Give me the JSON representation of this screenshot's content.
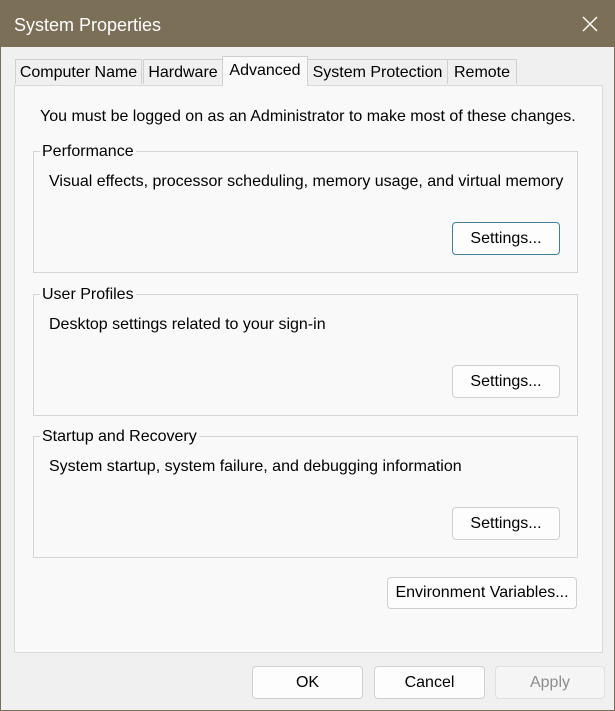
{
  "window": {
    "title": "System Properties",
    "close_icon": "close-icon"
  },
  "tabs": [
    {
      "label": "Computer Name",
      "active": false
    },
    {
      "label": "Hardware",
      "active": false
    },
    {
      "label": "Advanced",
      "active": true
    },
    {
      "label": "System Protection",
      "active": false
    },
    {
      "label": "Remote",
      "active": false
    }
  ],
  "advanced": {
    "admin_note": "You must be logged on as an Administrator to make most of these changes.",
    "performance": {
      "title": "Performance",
      "description": "Visual effects, processor scheduling, memory usage, and virtual memory",
      "button": "Settings..."
    },
    "user_profiles": {
      "title": "User Profiles",
      "description": "Desktop settings related to your sign-in",
      "button": "Settings..."
    },
    "startup_recovery": {
      "title": "Startup and Recovery",
      "description": "System startup, system failure, and debugging information",
      "button": "Settings..."
    },
    "env_vars_button": "Environment Variables..."
  },
  "footer": {
    "ok": "OK",
    "cancel": "Cancel",
    "apply": "Apply"
  },
  "colors": {
    "titlebar": "#7b6f57",
    "dialog_bg": "#f0f0f0",
    "panel_bg": "#f9f9f9",
    "focus_border": "#3f7f9a"
  }
}
